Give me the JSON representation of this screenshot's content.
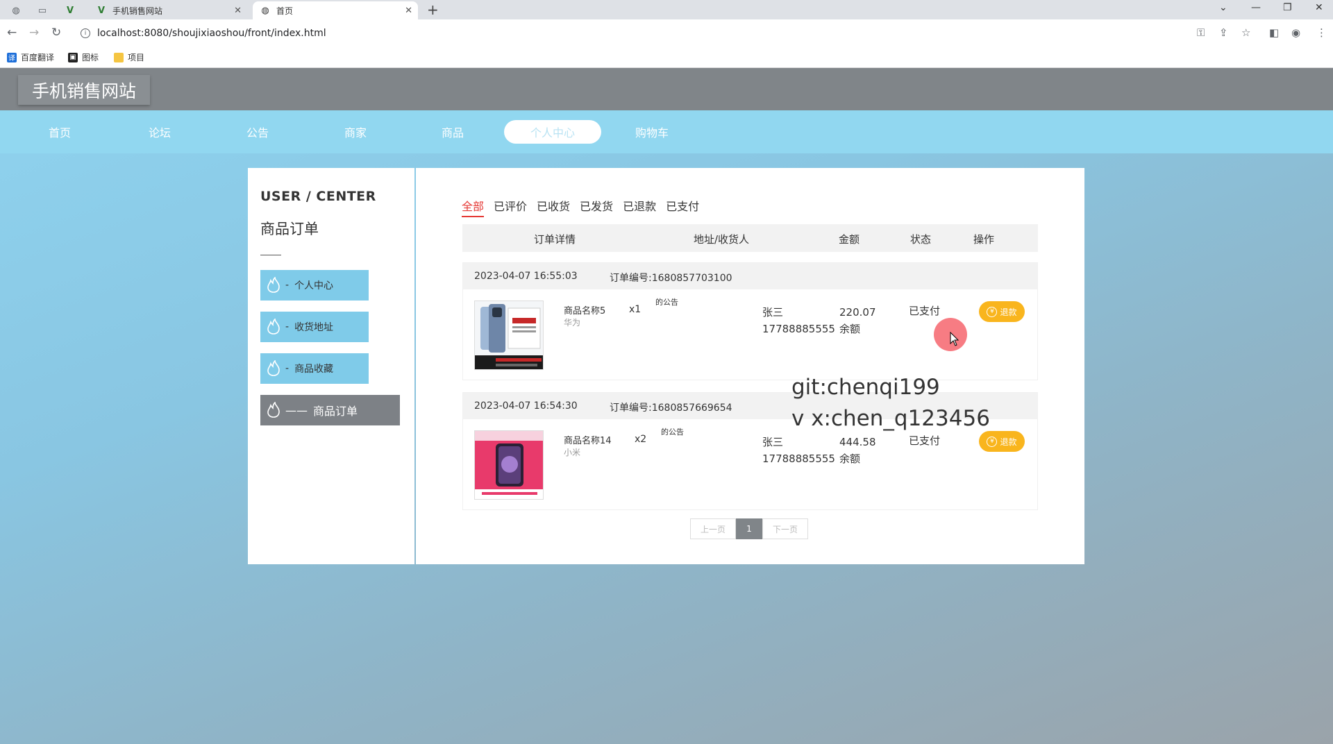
{
  "browser": {
    "tabs": [
      {
        "title": "手机销售网站",
        "active": false
      },
      {
        "title": "首页",
        "active": true
      }
    ],
    "url": "localhost:8080/shoujixiaoshou/front/index.html",
    "bookmarks": [
      "百度翻译",
      "图标",
      "项目"
    ]
  },
  "site": {
    "logo": "手机销售网站",
    "nav": [
      "首页",
      "论坛",
      "公告",
      "商家",
      "商品",
      "个人中心",
      "购物车"
    ],
    "nav_active": "个人中心"
  },
  "sidebar": {
    "title": "USER / CENTER",
    "subtitle": "商品订单",
    "items": [
      {
        "dash": "-",
        "label": "个人中心"
      },
      {
        "dash": "-",
        "label": "收货地址"
      },
      {
        "dash": "-",
        "label": "商品收藏"
      },
      {
        "dash": "——",
        "label": "商品订单"
      }
    ]
  },
  "orders_panel": {
    "filter_tabs": [
      "全部",
      "已评价",
      "已收货",
      "已发货",
      "已退款",
      "已支付"
    ],
    "active_tab": "全部",
    "columns": [
      "订单详情",
      "地址/收货人",
      "金额",
      "状态",
      "操作"
    ],
    "orders": [
      {
        "datetime": "2023-04-07 16:55:03",
        "order_no": "订单编号:1680857703100",
        "product_name": "商品名称5",
        "brand": "华为",
        "qty": "x1",
        "note": "的公告",
        "receiver": "张三",
        "phone": "17788885555",
        "amount": "220.07",
        "pay_method": "余额",
        "status": "已支付",
        "action": "退款"
      },
      {
        "datetime": "2023-04-07 16:54:30",
        "order_no": "订单编号:1680857669654",
        "product_name": "商品名称14",
        "brand": "小米",
        "qty": "x2",
        "note": "的公告",
        "receiver": "张三",
        "phone": "17788885555",
        "amount": "444.58",
        "pay_method": "余额",
        "status": "已支付",
        "action": "退款"
      }
    ],
    "pager": {
      "prev": "上一页",
      "current": "1",
      "next": "下一页"
    }
  },
  "watermark": [
    "git:chenqi199",
    "v x:chen_q123456"
  ],
  "colors": {
    "nav_bg": "#91d7f0",
    "header_bg": "#808589",
    "sidebar_btn": "#7fcbe9",
    "refund_btn": "#f9b51d",
    "active_tab": "#e53935"
  }
}
